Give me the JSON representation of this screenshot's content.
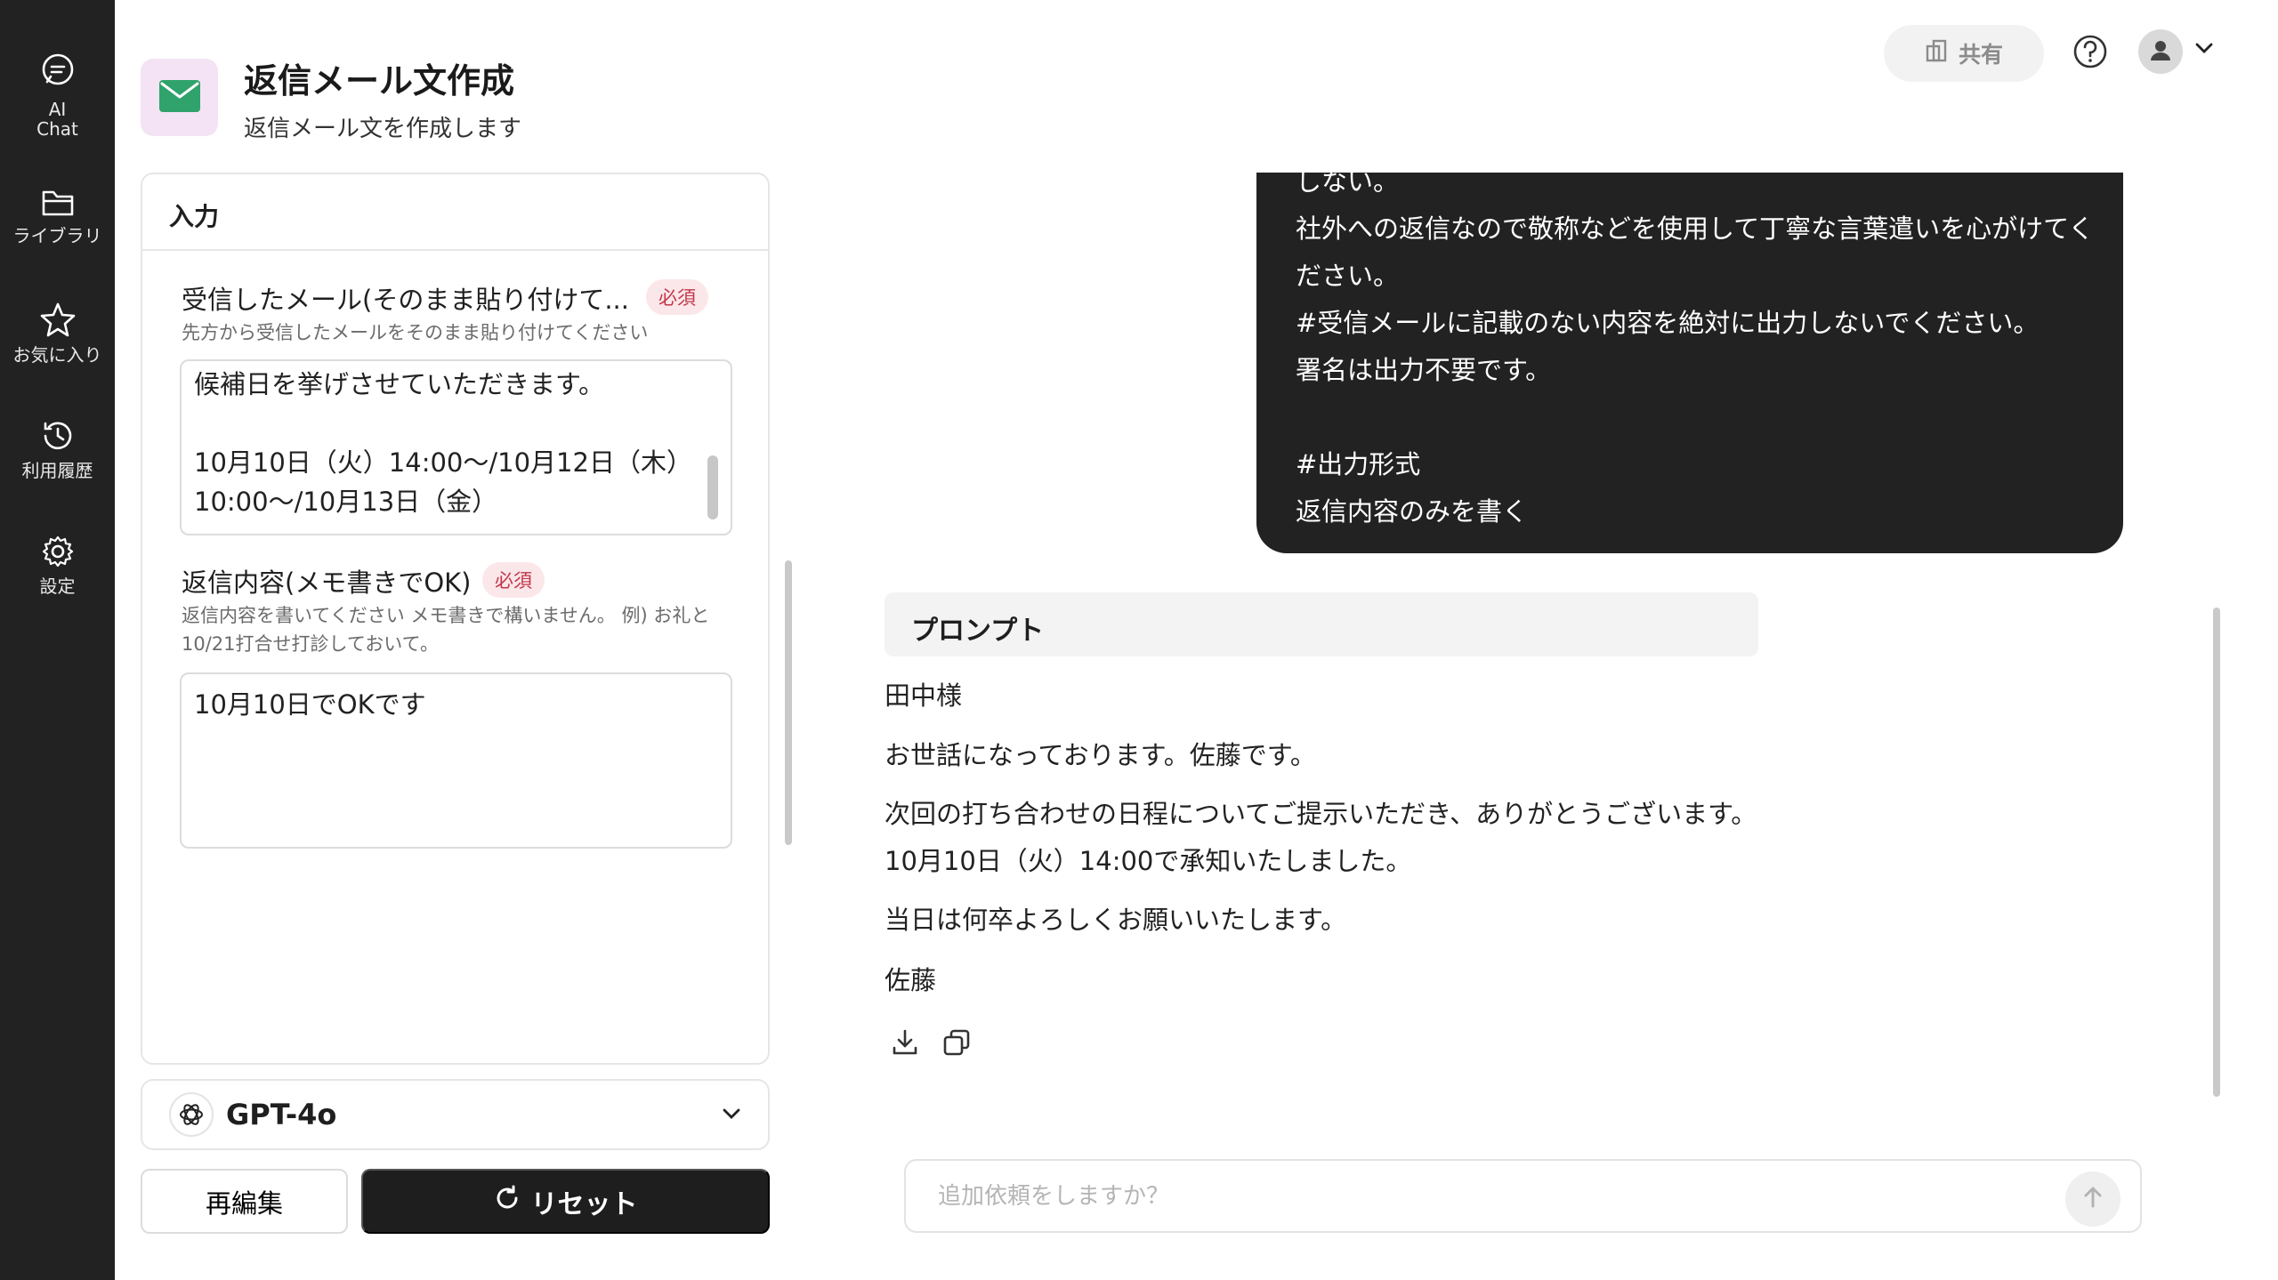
{
  "sidebar": {
    "items": [
      {
        "label": "AI\nChat",
        "icon": "chat-icon"
      },
      {
        "label": "ライブラリ",
        "icon": "folder-icon"
      },
      {
        "label": "お気に入り",
        "icon": "star-icon"
      },
      {
        "label": "利用履歴",
        "icon": "history-icon"
      },
      {
        "label": "設定",
        "icon": "gear-icon"
      }
    ]
  },
  "header": {
    "title": "返信メール文作成",
    "subtitle": "返信メール文を作成します",
    "share_label": "共有"
  },
  "input_panel": {
    "title": "入力",
    "received_field": {
      "label": "受信したメール(そのまま貼り付けて...",
      "badge": "必須",
      "hint": "先方から受信したメールをそのまま貼り付けてください",
      "line1": "候補日を挙げさせていただきます。",
      "line2": "10月10日（火）14:00〜/10月12日（木）",
      "line3": "10:00〜/10月13日（金）"
    },
    "reply_field": {
      "label": "返信内容(メモ書きでOK)",
      "badge": "必須",
      "hint_line1": "返信内容を書いてください メモ書きで構いません。 例) お礼と",
      "hint_line2": "10/21打合せ打診しておいて。",
      "value": "10月10日でOKです"
    }
  },
  "model": {
    "name": "GPT-4o"
  },
  "buttons": {
    "reedit": "再編集",
    "reset": "リセット"
  },
  "user_message": {
    "lines": [
      "しない。",
      "社外への返信なので敬称などを使用して丁寧な言葉遣いを心がけてく",
      "ださい。",
      "#受信メールに記載のない内容を絶対に出力しないでください。",
      "署名は出力不要です。",
      "",
      "#出力形式",
      "返信内容のみを書く"
    ]
  },
  "response": {
    "header": "プロンプト",
    "greeting": "田中様",
    "intro": "お世話になっております。佐藤です。",
    "body1": "次回の打ち合わせの日程についてご提示いただき、ありがとうございます。",
    "body2": "10月10日（火）14:00で承知いたしました。",
    "closing": "当日は何卒よろしくお願いいたします。",
    "signature": "佐藤"
  },
  "composer": {
    "placeholder": "追加依頼をしますか？"
  },
  "colors": {
    "sidebar_bg": "#222222",
    "required_badge_bg": "#fbe7e9",
    "required_badge_text": "#c2364b",
    "app_icon_bg": "#f3e3f4",
    "mail_icon": "#2fa36b"
  }
}
